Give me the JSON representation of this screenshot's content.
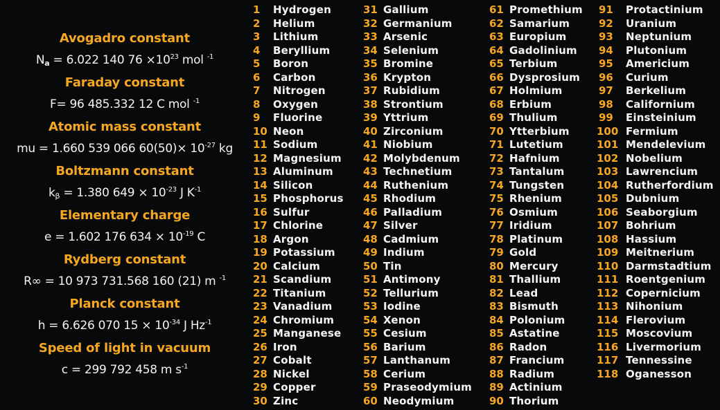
{
  "constants": [
    {
      "title": "Avogadro constant",
      "symbol": "N",
      "sub": "a",
      "value": " = 6.022 140 76 ×10",
      "exp": "23",
      "unit": " mol ",
      "unit_exp": "-1"
    },
    {
      "title": "Faraday constant",
      "symbol": "F",
      "sub": "",
      "value": "= 96 485.332 12 C mol ",
      "exp": "-1",
      "unit": "",
      "unit_exp": ""
    },
    {
      "title": "Atomic mass constant",
      "symbol": "mu",
      "sub": "",
      "value": " = 1.660 539 066 60(50)× 10",
      "exp": "-27",
      "unit": " kg",
      "unit_exp": ""
    },
    {
      "title": "Boltzmann constant",
      "symbol": "k",
      "sub": "β",
      "value": " = 1.380 649 × 10",
      "exp": "-23",
      "unit": " J K",
      "unit_exp": "-1"
    },
    {
      "title": "Elementary charge",
      "symbol": "e",
      "sub": "",
      "value": " = 1.602 176 634 × 10",
      "exp": "-19",
      "unit": " C",
      "unit_exp": ""
    },
    {
      "title": "Rydberg constant",
      "symbol": "R∞",
      "sub": "",
      "value": " = 10 973 731.568 160 (21) m ",
      "exp": "-1",
      "unit": "",
      "unit_exp": ""
    },
    {
      "title": "Planck constant",
      "symbol": "h",
      "sub": "",
      "value": " = 6.626 070 15 × 10",
      "exp": "-34",
      "unit": " J Hz",
      "unit_exp": "-1"
    },
    {
      "title": "Speed of light in vacuum",
      "symbol": "c",
      "sub": "",
      "value": " = 299 792 458 m s",
      "exp": "-1",
      "unit": "",
      "unit_exp": ""
    }
  ],
  "colors": {
    "accent": "#f5a623",
    "text": "#f4f4f4",
    "background": "#08090b"
  },
  "elements": [
    "Hydrogen",
    "Helium",
    "Lithium",
    "Beryllium",
    "Boron",
    "Carbon",
    "Nitrogen",
    "Oxygen",
    "Fluorine",
    "Neon",
    "Sodium",
    "Magnesium",
    "Aluminum",
    "Silicon",
    "Phosphorus",
    "Sulfur",
    "Chlorine",
    "Argon",
    "Potassium",
    "Calcium",
    "Scandium",
    "Titanium",
    "Vanadium",
    "Chromium",
    "Manganese",
    "Iron",
    "Cobalt",
    "Nickel",
    "Copper",
    "Zinc",
    "Gallium",
    "Germanium",
    "Arsenic",
    "Selenium",
    "Bromine",
    "Krypton",
    "Rubidium",
    "Strontium",
    "Yttrium",
    "Zirconium",
    "Niobium",
    "Molybdenum",
    "Technetium",
    "Ruthenium",
    "Rhodium",
    "Palladium",
    "Silver",
    "Cadmium",
    "Indium",
    "Tin",
    "Antimony",
    "Tellurium",
    "Iodine",
    "Xenon",
    "Cesium",
    "Barium",
    "Lanthanum",
    "Cerium",
    "Praseodymium",
    "Neodymium",
    "Promethium",
    "Samarium",
    "Europium",
    "Gadolinium",
    "Terbium",
    "Dysprosium",
    "Holmium",
    "Erbium",
    "Thulium",
    "Ytterbium",
    "Lutetium",
    "Hafnium",
    "Tantalum",
    "Tungsten",
    "Rhenium",
    "Osmium",
    "Iridium",
    "Platinum",
    "Gold",
    "Mercury",
    "Thallium",
    "Lead",
    "Bismuth",
    "Polonium",
    "Astatine",
    "Radon",
    "Francium",
    "Radium",
    "Actinium",
    "Thorium",
    "Protactinium",
    "Uranium",
    "Neptunium",
    "Plutonium",
    "Americium",
    "Curium",
    "Berkelium",
    "Californium",
    "Einsteinium",
    "Fermium",
    "Mendelevium",
    "Nobelium",
    "Lawrencium",
    "Rutherfordium",
    "Dubnium",
    "Seaborgium",
    "Bohrium",
    "Hassium",
    "Meitnerium",
    "Darmstadtium",
    "Roentgenium",
    "Copernicium",
    "Nihonium",
    "Flerovium",
    "Moscovium",
    "Livermorium",
    "Tennessine",
    "Oganesson"
  ]
}
